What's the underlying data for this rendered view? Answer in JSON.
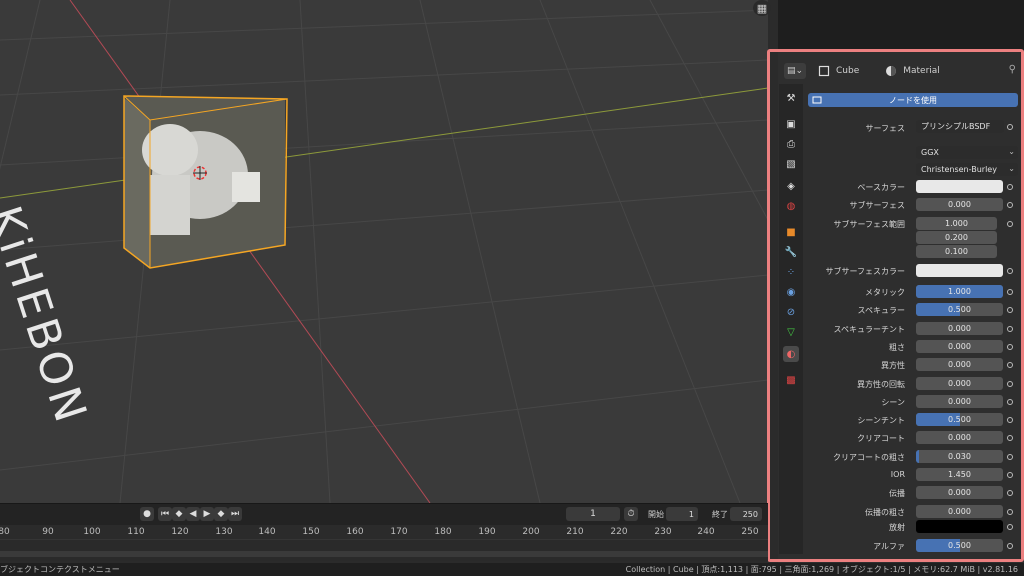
{
  "viewport": {
    "ghost_text": "KiHEBON"
  },
  "properties": {
    "header": {
      "object_name": "Cube",
      "material_tab": "Material",
      "editor_icon": "properties-editor-icon"
    },
    "use_nodes_label": "ノードを使用",
    "surface": {
      "label": "サーフェス",
      "value": "プリンシプルBSDF"
    },
    "distribution": "GGX",
    "subsurface_method": "Christensen-Burley",
    "base_color": {
      "label": "ベースカラー",
      "color": "#e8e8e8"
    },
    "subsurface": {
      "label": "サブサーフェス",
      "value": "0.000"
    },
    "subsurface_radius": {
      "label": "サブサーフェス範囲",
      "values": [
        "1.000",
        "0.200",
        "0.100"
      ]
    },
    "subsurface_color": {
      "label": "サブサーフェスカラー",
      "color": "#e8e8e8"
    },
    "params": [
      {
        "label": "メタリック",
        "value": "1.000",
        "fraction": 1.0
      },
      {
        "label": "スペキュラー",
        "value": "0.500",
        "fraction": 0.5
      },
      {
        "label": "スペキュラーチント",
        "value": "0.000",
        "fraction": 0
      },
      {
        "label": "粗さ",
        "value": "0.000",
        "fraction": 0
      },
      {
        "label": "異方性",
        "value": "0.000",
        "fraction": 0
      },
      {
        "label": "異方性の回転",
        "value": "0.000",
        "fraction": 0
      },
      {
        "label": "シーン",
        "value": "0.000",
        "fraction": 0
      },
      {
        "label": "シーンチント",
        "value": "0.500",
        "fraction": 0.5
      },
      {
        "label": "クリアコート",
        "value": "0.000",
        "fraction": 0
      },
      {
        "label": "クリアコートの粗さ",
        "value": "0.030",
        "fraction": 0.03
      },
      {
        "label": "IOR",
        "value": "1.450",
        "fraction": 0
      },
      {
        "label": "伝播",
        "value": "0.000",
        "fraction": 0
      },
      {
        "label": "伝播の粗さ",
        "value": "0.000",
        "fraction": 0
      }
    ],
    "emission": {
      "label": "放射",
      "color": "#000000"
    },
    "alpha": {
      "label": "アルファ",
      "value": "0.500",
      "fraction": 0.5
    }
  },
  "timeline": {
    "current_frame": "1",
    "start_label": "開始",
    "start_value": "1",
    "end_label": "終了",
    "end_value": "250",
    "ticks": [
      "80",
      "90",
      "100",
      "110",
      "120",
      "130",
      "140",
      "150",
      "160",
      "170",
      "180",
      "190",
      "200",
      "210",
      "220",
      "230",
      "240",
      "250"
    ]
  },
  "statusbar": {
    "left": "ブジェクトコンテクストメニュー",
    "right": "Collection | Cube | 頂点:1,113 | 面:795 | 三角面:1,269 | オブジェクト:1/5 | メモリ:62.7 MiB | v2.81.16"
  },
  "colors": {
    "accent": "#4772b3",
    "highlight_frame": "#ec8080",
    "selection_outline": "#f5a623"
  }
}
